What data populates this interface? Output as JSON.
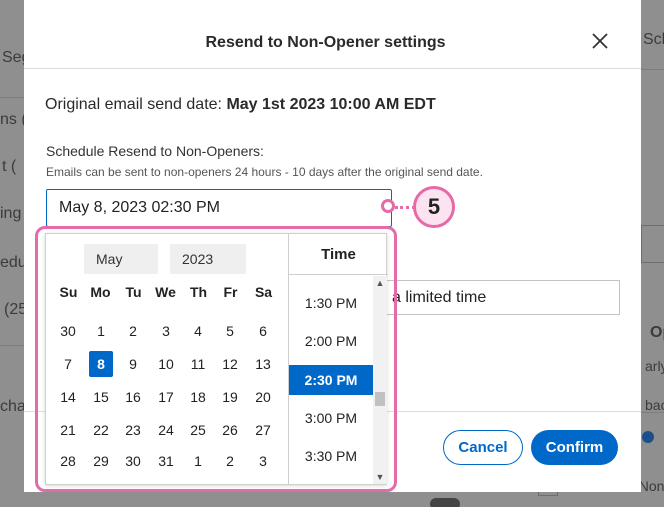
{
  "background": {
    "fragments": [
      "Seg",
      "ns (",
      "t (",
      "ing",
      "edul",
      "(25",
      "cha",
      "Sche",
      "Opt",
      "arly",
      "bac"
    ],
    "footer_checkbox_label": "Resend to Non"
  },
  "modal": {
    "title": "Resend to Non-Opener settings",
    "original_date_label": "Original email send date:",
    "original_date_value": "May 1st 2023 10:00 AM EDT",
    "schedule_label": "Schedule Resend to Non-Openers:",
    "schedule_help": "Emails can be sent to non-openers 24 hours - 10 days after the original send date.",
    "date_value": "May 8, 2023 02:30 PM",
    "subject_partial": "a limited time",
    "cancel_label": "Cancel",
    "confirm_label": "Confirm"
  },
  "picker": {
    "month": "May",
    "year": "2023",
    "weekdays": [
      "Su",
      "Mo",
      "Tu",
      "We",
      "Th",
      "Fr",
      "Sa"
    ],
    "weeks": [
      [
        "30",
        "1",
        "2",
        "3",
        "4",
        "5",
        "6"
      ],
      [
        "7",
        "8",
        "9",
        "10",
        "11",
        "12",
        "13"
      ],
      [
        "14",
        "15",
        "16",
        "17",
        "18",
        "19",
        "20"
      ],
      [
        "21",
        "22",
        "23",
        "24",
        "25",
        "26",
        "27"
      ],
      [
        "28",
        "29",
        "30",
        "31",
        "1",
        "2",
        "3"
      ]
    ],
    "selected_day": "8",
    "time_header": "Time",
    "times": [
      "1:30 PM",
      "2:00 PM",
      "2:30 PM",
      "3:00 PM",
      "3:30 PM"
    ],
    "selected_time": "2:30 PM"
  },
  "annotation": {
    "step": "5",
    "color": "#e76aa8"
  },
  "colors": {
    "accent": "#0068c9"
  }
}
